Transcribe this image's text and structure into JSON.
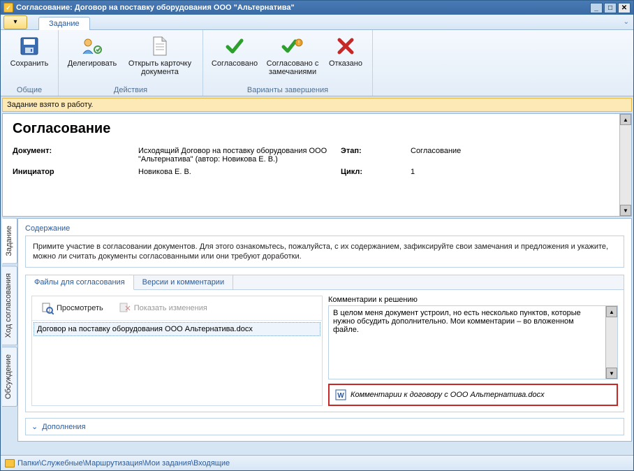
{
  "window": {
    "title": "Согласование: Договор на поставку оборудования ООО \"Альтернатива\""
  },
  "ribbon": {
    "tab": "Задание",
    "groups": {
      "common": {
        "title": "Общие",
        "save": "Сохранить"
      },
      "actions": {
        "title": "Действия",
        "delegate": "Делегировать",
        "open_card": "Открыть карточку документа"
      },
      "complete": {
        "title": "Варианты завершения",
        "agreed": "Согласовано",
        "agreed_notes": "Согласовано с замечаниями",
        "refused": "Отказано"
      }
    }
  },
  "status_message": "Задание взято в работу.",
  "header": {
    "title": "Согласование",
    "document_label": "Документ:",
    "document_value": "Исходящий Договор на поставку оборудования ООО \"Альтернатива\" (автор: Новикова Е. В.)",
    "stage_label": "Этап:",
    "stage_value": "Согласование",
    "initiator_label": "Инициатор",
    "initiator_value": "Новикова Е. В.",
    "cycle_label": "Цикл:",
    "cycle_value": "1"
  },
  "side_tabs": {
    "task": "Задание",
    "progress": "Ход согласования",
    "discussion": "Обсуждение"
  },
  "content_panel": {
    "label": "Содержание",
    "instruction": "Примите участие в согласовании документов. Для этого ознакомьтесь, пожалуйста, с их содержанием, зафиксируйте свои замечания и предложения и укажите, можно ли считать документы согласованными или они требуют доработки."
  },
  "inner_tabs": {
    "files": "Файлы для согласования",
    "versions": "Версии и комментарии"
  },
  "files": {
    "view_btn": "Просмотреть",
    "show_changes_btn": "Показать изменения",
    "item": "Договор на поставку оборудования ООО Альтернатива.docx"
  },
  "comments": {
    "label": "Комментарии к решению",
    "text": "В целом меня документ устроил, но есть несколько пунктов, которые нужно обсудить дополнительно. Мои комментарии – во вложенном файле.",
    "attachment": "Комментарии к договору с ООО Альтернатива.docx"
  },
  "addendum_label": "Дополнения",
  "breadcrumb": "Папки\\Служебные\\Маршрутизация\\Мои задания\\Входящие"
}
